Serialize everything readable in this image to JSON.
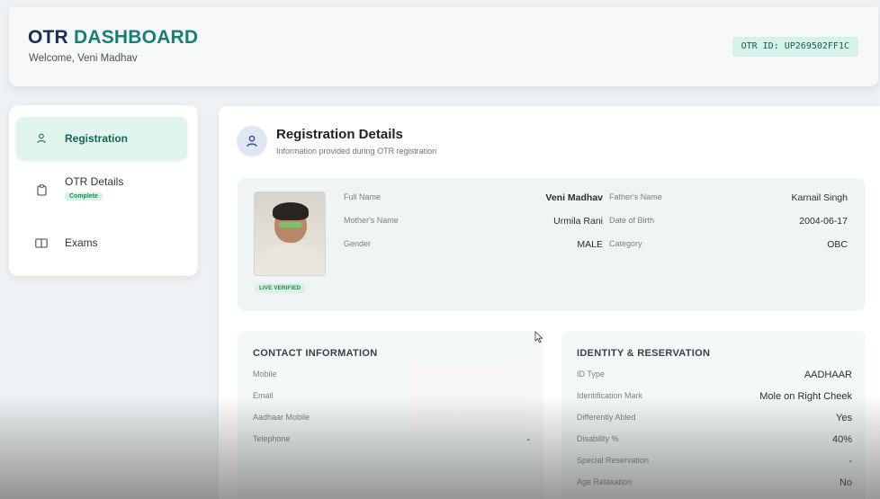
{
  "header": {
    "brand_part1": "OTR",
    "brand_part2": "DASHBOARD",
    "welcome": "Welcome, Veni Madhav",
    "otr_id": "OTR ID: UP269502FF1C"
  },
  "sidebar": {
    "items": [
      {
        "label": "Registration",
        "icon": "user-icon",
        "active": true
      },
      {
        "label": "OTR Details",
        "icon": "clipboard-icon",
        "badge": "Complete"
      },
      {
        "label": "Exams",
        "icon": "book-icon"
      }
    ]
  },
  "section": {
    "title": "Registration Details",
    "subtitle": "Information provided during OTR registration"
  },
  "profile": {
    "live_label": "LIVE VERIFIED",
    "full_name_label": "Full Name",
    "full_name": "Veni Madhav",
    "mother_label": "Mother's Name",
    "mother": "Urmila Rani",
    "gender_label": "Gender",
    "gender": "MALE",
    "father_label": "Father's Name",
    "father": "Karnail Singh",
    "dob_label": "Date of Birth",
    "dob": "2004-06-17",
    "category_label": "Category",
    "category": "OBC"
  },
  "contact": {
    "title": "CONTACT INFORMATION",
    "rows": [
      {
        "label": "Mobile",
        "value": ""
      },
      {
        "label": "Email",
        "value": ""
      },
      {
        "label": "Aadhaar Mobile",
        "value": ""
      },
      {
        "label": "Telephone",
        "value": "-"
      }
    ]
  },
  "identity": {
    "title": "IDENTITY & RESERVATION",
    "rows": [
      {
        "label": "ID Type",
        "value": "AADHAAR"
      },
      {
        "label": "Identification Mark",
        "value": "Mole on Right Cheek"
      },
      {
        "label": "Differently Abled",
        "value": "Yes"
      },
      {
        "label": "Disability %",
        "value": "40%"
      },
      {
        "label": "Special Reservation",
        "value": "-"
      },
      {
        "label": "Age Relaxation",
        "value": "No"
      }
    ]
  },
  "colors": {
    "brand_dark": "#1c2b57",
    "brand_teal": "#1a7e74",
    "active_bg": "#e1f4ee",
    "badge_green": "#1f8a4e"
  }
}
